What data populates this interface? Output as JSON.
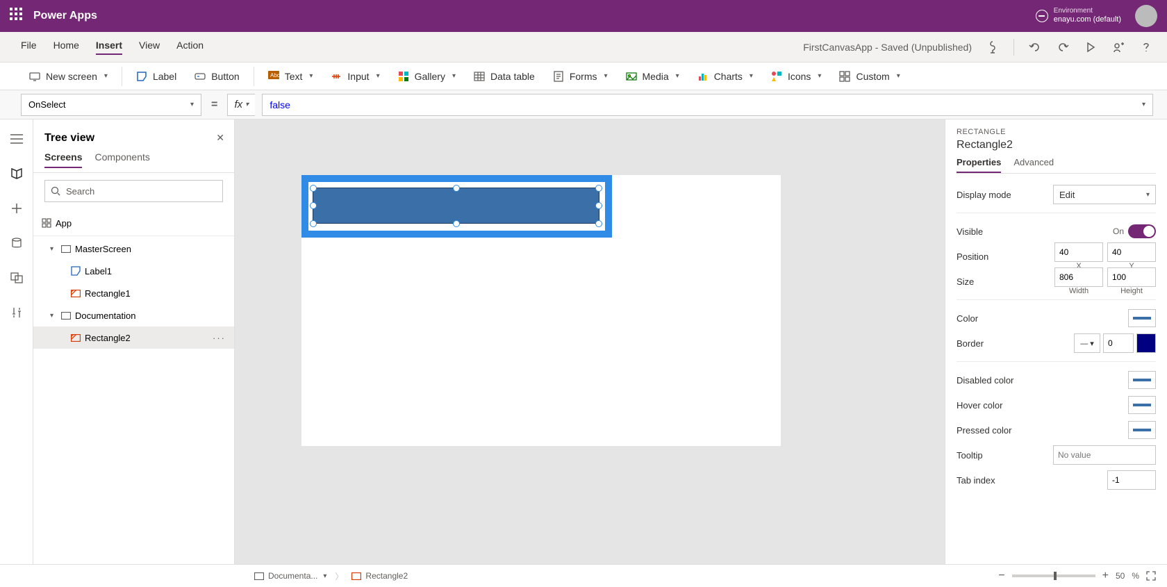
{
  "header": {
    "product": "Power Apps",
    "env_label": "Environment",
    "env_name": "enayu.com (default)"
  },
  "menu": {
    "items": [
      "File",
      "Home",
      "Insert",
      "View",
      "Action"
    ],
    "active": "Insert",
    "app_status": "FirstCanvasApp - Saved (Unpublished)"
  },
  "insert_toolbar": {
    "new_screen": "New screen",
    "label": "Label",
    "button": "Button",
    "text": "Text",
    "input": "Input",
    "gallery": "Gallery",
    "data_table": "Data table",
    "forms": "Forms",
    "media": "Media",
    "charts": "Charts",
    "icons": "Icons",
    "custom": "Custom"
  },
  "formula": {
    "property": "OnSelect",
    "value": "false",
    "fx": "fx"
  },
  "tree": {
    "title": "Tree view",
    "tabs": [
      "Screens",
      "Components"
    ],
    "active_tab": "Screens",
    "search_placeholder": "Search",
    "nodes": {
      "app": "App",
      "master": "MasterScreen",
      "label1": "Label1",
      "rect1": "Rectangle1",
      "doc": "Documentation",
      "rect2": "Rectangle2"
    }
  },
  "properties": {
    "type_label": "RECTANGLE",
    "name": "Rectangle2",
    "tabs": [
      "Properties",
      "Advanced"
    ],
    "display_mode_label": "Display mode",
    "display_mode_value": "Edit",
    "visible_label": "Visible",
    "visible_value": "On",
    "position_label": "Position",
    "x": "40",
    "y": "40",
    "x_label": "X",
    "y_label": "Y",
    "size_label": "Size",
    "width": "806",
    "height": "100",
    "width_label": "Width",
    "height_label": "Height",
    "color_label": "Color",
    "border_label": "Border",
    "border_value": "0",
    "disabled_label": "Disabled color",
    "hover_label": "Hover color",
    "pressed_label": "Pressed color",
    "tooltip_label": "Tooltip",
    "tooltip_placeholder": "No value",
    "tabindex_label": "Tab index",
    "tabindex_value": "-1"
  },
  "bottombar": {
    "screen": "Documenta...",
    "control": "Rectangle2",
    "zoom": "50",
    "pct": "%"
  }
}
